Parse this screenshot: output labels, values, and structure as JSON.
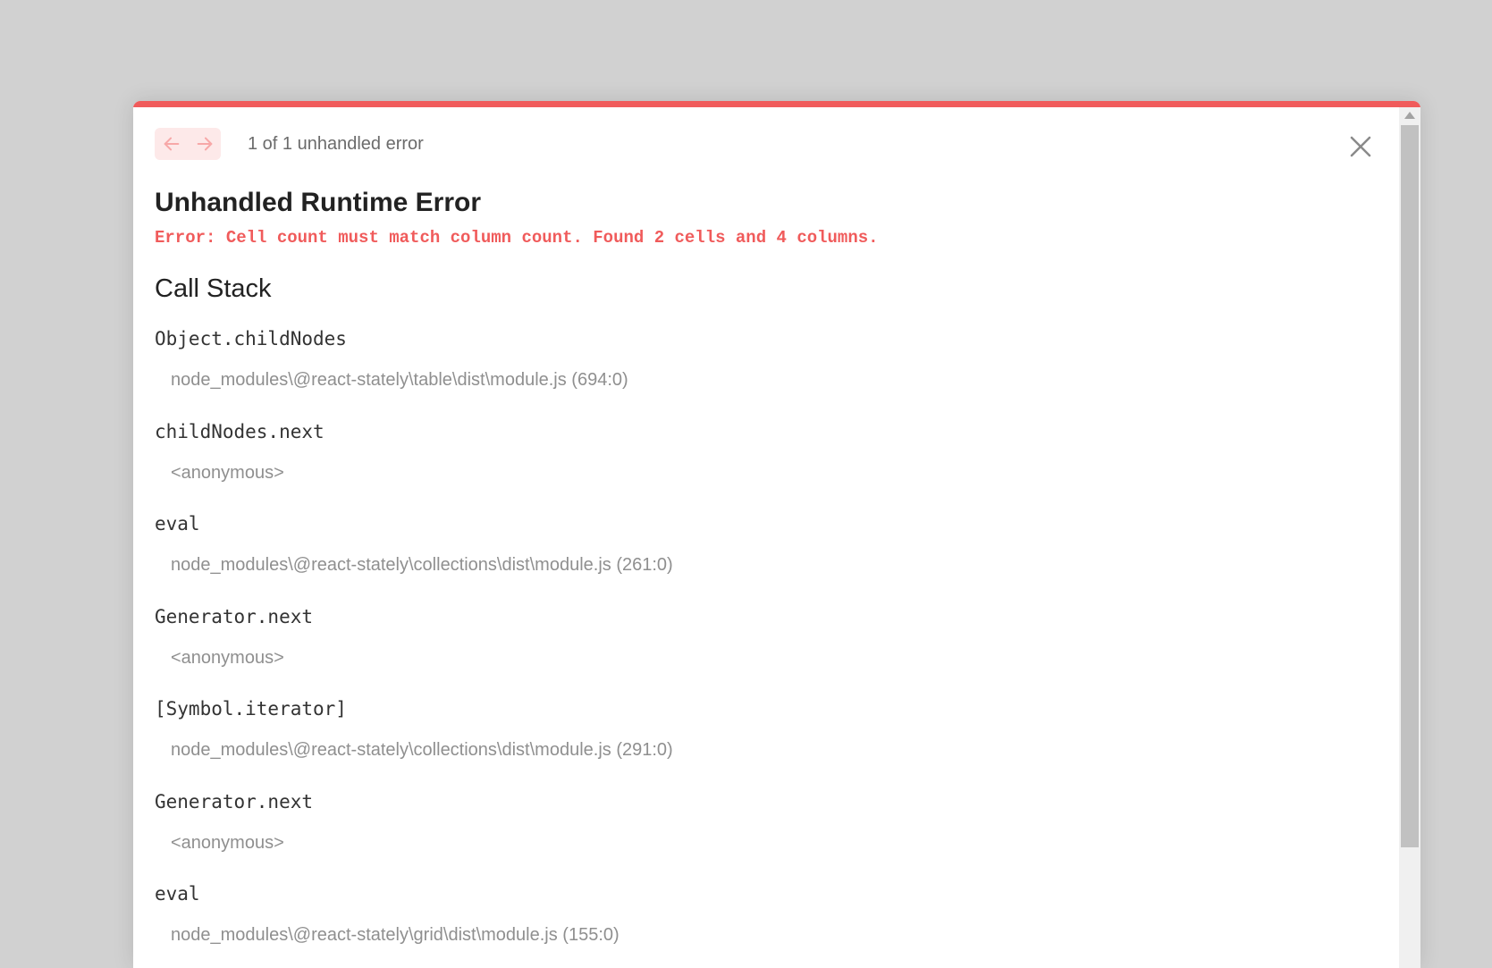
{
  "header": {
    "prev_icon": "arrow-left-icon",
    "next_icon": "arrow-right-icon",
    "error_count": "1 of 1 unhandled error",
    "close_icon": "close-icon"
  },
  "error": {
    "title": "Unhandled Runtime Error",
    "message": "Error: Cell count must match column count. Found 2 cells and 4 columns."
  },
  "call_stack": {
    "title": "Call Stack",
    "frames": [
      {
        "name": "Object.childNodes",
        "location": "node_modules\\@react-stately\\table\\dist\\module.js (694:0)"
      },
      {
        "name": "childNodes.next",
        "location": "<anonymous>"
      },
      {
        "name": "eval",
        "location": "node_modules\\@react-stately\\collections\\dist\\module.js (261:0)"
      },
      {
        "name": "Generator.next",
        "location": "<anonymous>"
      },
      {
        "name": "[Symbol.iterator]",
        "location": "node_modules\\@react-stately\\collections\\dist\\module.js (291:0)"
      },
      {
        "name": "Generator.next",
        "location": "<anonymous>"
      },
      {
        "name": "eval",
        "location": "node_modules\\@react-stately\\grid\\dist\\module.js (155:0)"
      }
    ]
  },
  "colors": {
    "accent": "#f05b5b",
    "nav_bg": "#fde9e9",
    "backdrop": "#d1d1d1"
  }
}
